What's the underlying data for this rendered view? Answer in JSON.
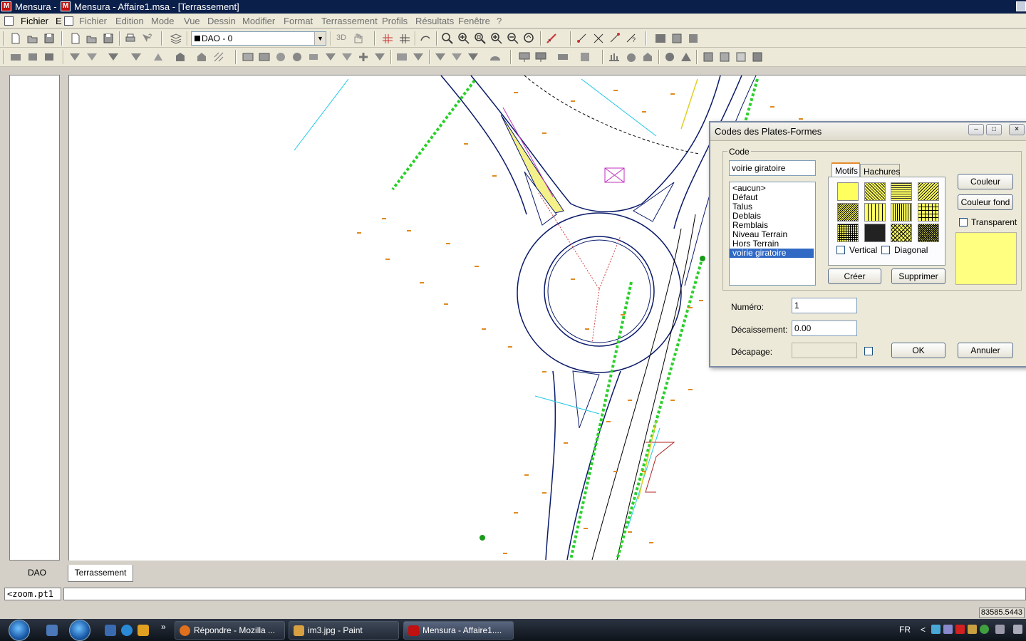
{
  "window": {
    "title_left": "Mensura - ",
    "title_main": "Mensura - Affaire1.msa - [Terrassement]"
  },
  "menubar": {
    "outer_item": "Fichier",
    "outer_item_cut": "E",
    "items": [
      "Fichier",
      "Edition",
      "Mode",
      "Vue",
      "Dessin",
      "Modifier",
      "Format",
      "Terrassement",
      "Profils",
      "Résultats",
      "Fenêtre",
      "?"
    ]
  },
  "toolbar": {
    "layer_value": "DAO - 0",
    "view_3d_label": "3D"
  },
  "tabs": {
    "inactive": "DAO",
    "active": "Terrassement"
  },
  "command": {
    "prompt": "<zoom.pt1",
    "input": ""
  },
  "status": {
    "coordinate": "83585.5443"
  },
  "taskbar": {
    "tasks": [
      {
        "label": "Répondre - Mozilla ...",
        "icon": "firefox-icon",
        "color": "#e0701c"
      },
      {
        "label": "im3.jpg - Paint",
        "icon": "paint-icon",
        "color": "#d8a040"
      },
      {
        "label": "Mensura - Affaire1....",
        "icon": "mensura-icon",
        "color": "#c01010"
      }
    ],
    "chevron": "»",
    "lang": "FR",
    "tray_chevron": "<"
  },
  "dialog": {
    "title": "Codes des Plates-Formes",
    "group_label": "Code",
    "code_value": "voirie giratoire",
    "codes": [
      "<aucun>",
      "Défaut",
      "Talus",
      "Deblais",
      "Remblais",
      "Niveau Terrain",
      "Hors Terrain",
      "voirie giratoire"
    ],
    "selected_code": "voirie giratoire",
    "tab_motifs": "Motifs",
    "tab_hachures": "Hachures",
    "vertical_label": "Vertical",
    "diagonal_label": "Diagonal",
    "create_label": "Créer",
    "delete_label": "Supprimer",
    "couleur_label": "Couleur",
    "couleur_fond_label": "Couleur fond",
    "transparent_label": "Transparent",
    "numero_label": "Numéro:",
    "numero_value": "1",
    "decaissement_label": "Décaissement:",
    "decaissement_value": "0.00",
    "decapage_label": "Décapage:",
    "decapage_value": "",
    "ok_label": "OK",
    "cancel_label": "Annuler",
    "preview_color": "#ffff80"
  }
}
